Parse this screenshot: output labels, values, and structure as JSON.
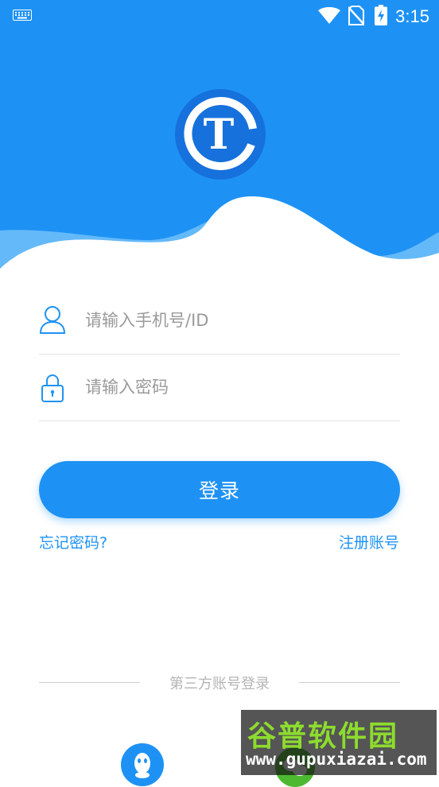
{
  "status_bar": {
    "time": "3:15",
    "icons": [
      "keyboard-icon",
      "wifi-icon",
      "no-sim-icon",
      "battery-charging-icon"
    ]
  },
  "logo": {
    "letter": "T"
  },
  "login_form": {
    "account_placeholder": "请输入手机号/ID",
    "password_placeholder": "请输入密码",
    "login_label": "登录"
  },
  "links": {
    "forgot_password": "忘记密码?",
    "register": "注册账号"
  },
  "third_party": {
    "label": "第三方账号登录",
    "providers": [
      "qq-icon",
      "wechat-icon"
    ]
  },
  "watermark": {
    "title": "谷普软件园",
    "url": "www.gupuxiazai.com"
  },
  "colors": {
    "primary": "#1e92f4",
    "wave_light": "#64b9f8",
    "background": "#ffffff"
  }
}
